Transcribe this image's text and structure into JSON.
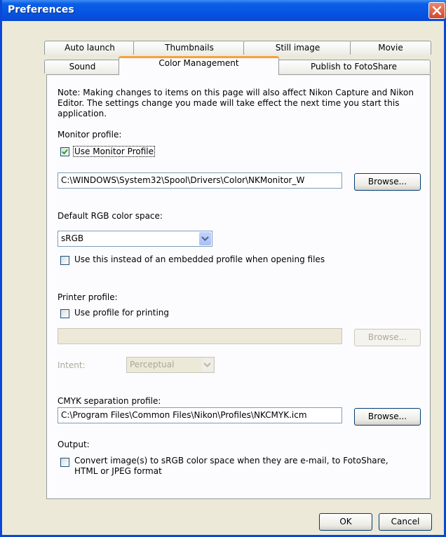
{
  "window": {
    "title": "Preferences"
  },
  "tabs_row1": [
    {
      "label": "Auto launch"
    },
    {
      "label": "Thumbnails"
    },
    {
      "label": "Still image"
    },
    {
      "label": "Movie"
    }
  ],
  "tabs_row2": [
    {
      "label": "Sound"
    },
    {
      "label": "Color Management"
    },
    {
      "label": "Publish to FotoShare"
    }
  ],
  "note": "Note:  Making changes to items on this page will also affect Nikon Capture and Nikon Editor. The settings change you made will take effect the next time you start this application.",
  "monitor": {
    "section_label": "Monitor profile:",
    "checkbox_label": "Use Monitor Profile",
    "checked": true,
    "path": "C:\\WINDOWS\\System32\\Spool\\Drivers\\Color\\NKMonitor_W",
    "browse_label": "Browse..."
  },
  "rgb": {
    "section_label": "Default RGB color space:",
    "selected": "sRGB",
    "checkbox_label": "Use this instead of an embedded profile when opening files",
    "checked": false
  },
  "printer": {
    "section_label": "Printer profile:",
    "checkbox_label": "Use profile for printing",
    "checked": false,
    "path": "",
    "browse_label": "Browse...",
    "intent_label": "Intent:",
    "intent_value": "Perceptual"
  },
  "cmyk": {
    "section_label": "CMYK separation profile:",
    "path": "C:\\Program Files\\Common Files\\Nikon\\Profiles\\NKCMYK.icm",
    "browse_label": "Browse..."
  },
  "output": {
    "section_label": "Output:",
    "checkbox_label": "Convert image(s) to sRGB color space when they are e-mail, to FotoShare, HTML or JPEG format",
    "checked": false
  },
  "footer": {
    "ok_label": "OK",
    "cancel_label": "Cancel"
  }
}
